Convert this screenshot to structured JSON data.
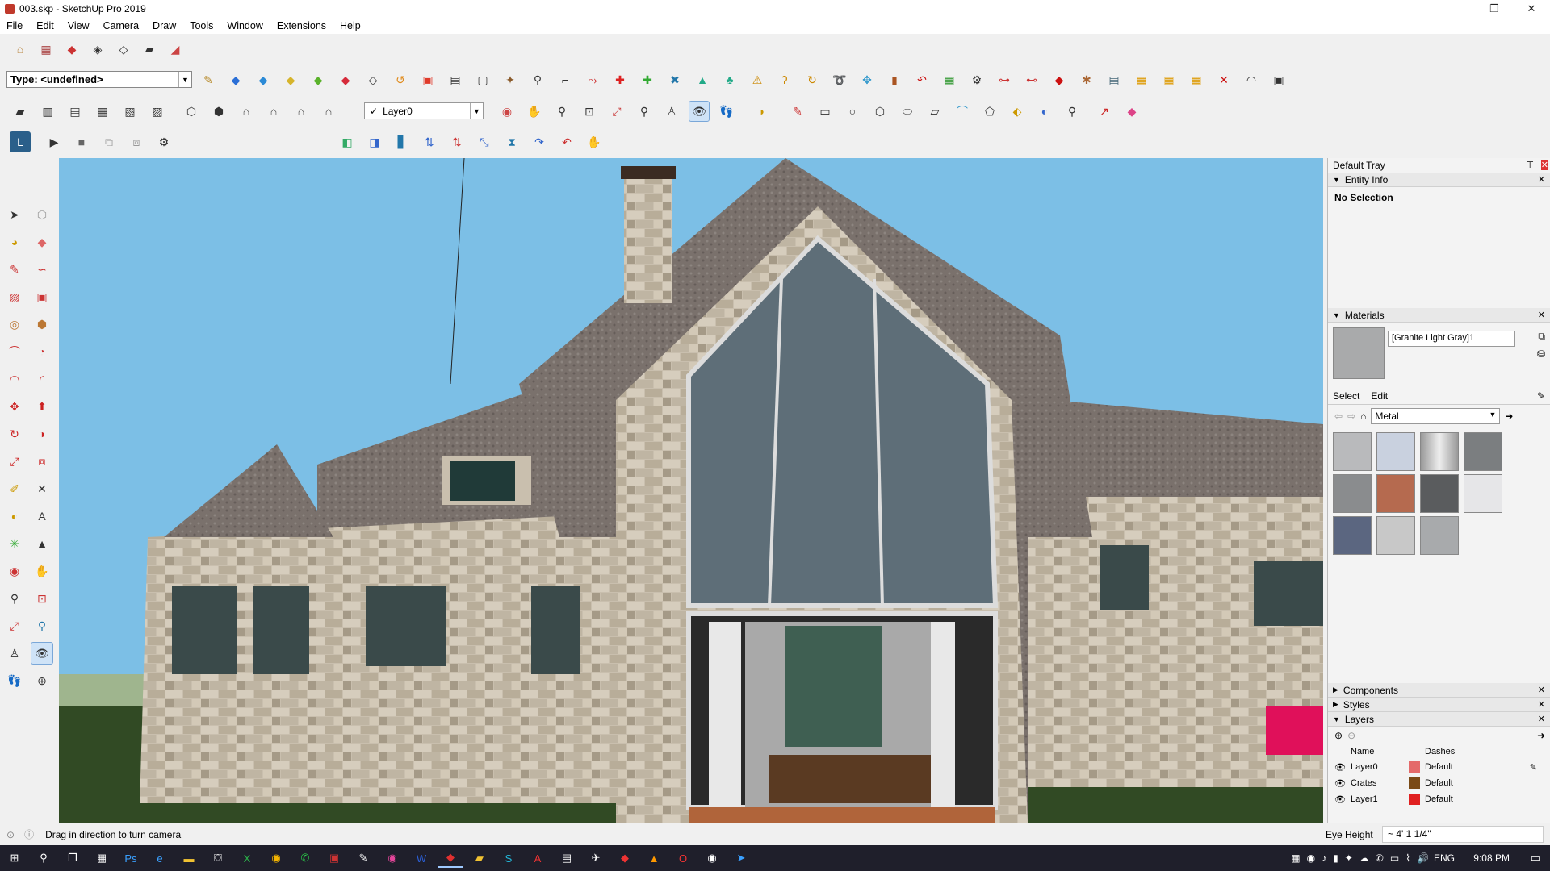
{
  "window": {
    "title": "003.skp - SketchUp Pro 2019",
    "minimize": "—",
    "restore": "❐",
    "close": "✕"
  },
  "menu": [
    "File",
    "Edit",
    "View",
    "Camera",
    "Draw",
    "Tools",
    "Window",
    "Extensions",
    "Help"
  ],
  "toolbar": {
    "type_label": "Type: <undefined>",
    "layer_value": "Layer0"
  },
  "left_tools_icons": [
    "select-icon",
    "make-component-icon",
    "paint-bucket-icon",
    "eraser-icon",
    "pencil-icon",
    "freehand-icon",
    "rectangle-icon",
    "rotated-rectangle-icon",
    "circle-icon",
    "polygon-icon",
    "arc-icon",
    "pie-icon",
    "two-point-arc-icon",
    "three-point-arc-icon",
    "move-icon",
    "push-pull-icon",
    "rotate-icon",
    "follow-me-icon",
    "scale-icon",
    "offset-icon",
    "tape-measure-icon",
    "dimension-icon",
    "protractor-icon",
    "text-icon",
    "axes-icon",
    "3d-text-icon",
    "orbit-icon",
    "pan-icon",
    "zoom-icon",
    "zoom-window-icon",
    "zoom-extents-icon",
    "previous-view-icon",
    "position-camera-icon",
    "look-around-icon",
    "walk-icon",
    "section-plane-icon"
  ],
  "tray": {
    "title": "Default Tray",
    "entity_info": {
      "header": "Entity Info",
      "value": "No Selection"
    },
    "materials": {
      "header": "Materials",
      "name": "[Granite Light Gray]1",
      "tab_select": "Select",
      "tab_edit": "Edit",
      "collection": "Metal",
      "swatches": [
        "#b9babc",
        "#c9d1df",
        "#d6d6d6",
        "#7b7e80",
        "#8a8c8e",
        "#b56a4f",
        "#5a5c5e",
        "#e6e6e8",
        "#5b6680",
        "#c8c8c8",
        "#a8aaac"
      ]
    },
    "components": {
      "header": "Components"
    },
    "styles": {
      "header": "Styles"
    },
    "layers": {
      "header": "Layers",
      "col_name": "Name",
      "col_dashes": "Dashes",
      "rows": [
        {
          "name": "Layer0",
          "color": "#e46a6a",
          "dashes": "Default"
        },
        {
          "name": "Crates",
          "color": "#7a4a16",
          "dashes": "Default"
        },
        {
          "name": "Layer1",
          "color": "#e02020",
          "dashes": "Default"
        }
      ]
    }
  },
  "status": {
    "hint": "Drag in direction to turn camera",
    "measure_label": "Eye Height",
    "measure_value": "~ 4' 1 1/4\""
  },
  "taskbar": {
    "lang": "ENG",
    "time": "9:08 PM"
  }
}
